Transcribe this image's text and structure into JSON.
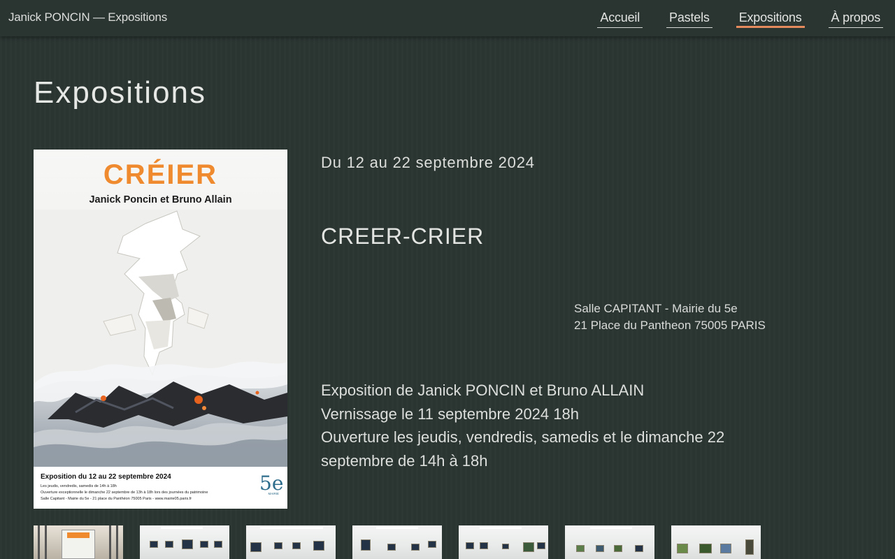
{
  "header": {
    "site_title": "Janick PONCIN — Expositions",
    "nav": [
      {
        "label": "Accueil",
        "active": false
      },
      {
        "label": "Pastels",
        "active": false
      },
      {
        "label": "Expositions",
        "active": true
      },
      {
        "label": "À propos",
        "active": false
      }
    ],
    "accent_color": "#e58a5c"
  },
  "page": {
    "title": "Expositions"
  },
  "exhibition": {
    "date": "Du 12 au 22 septembre 2024",
    "title": "CREER-CRIER",
    "venue_line1": "Salle CAPITANT - Mairie du 5e",
    "venue_line2": "21 Place du Pantheon 75005 PARIS",
    "description": [
      "Exposition de Janick PONCIN et Bruno ALLAIN",
      "Vernissage le 11 septembre 2024 18h",
      "Ouverture les jeudis, vendredis, samedis et le dimanche 22 septembre de 14h à 18h"
    ],
    "poster": {
      "title": "CRÉIER",
      "artists": "Janick Poncin et Bruno Allain",
      "footer_main": "Exposition du 12 au 22 septembre 2024",
      "footer_line1": "Les jeudis, vendredis, samedis de 14h à 18h",
      "footer_line2": "Ouverture exceptionnelle le dimanche 22 septembre de 13h à 18h lors des journées du patrimoine",
      "footer_line3": "Salle Capitant - Mairie du 5e - 21 place du Panthéon 75005 Paris - www.mairie05.paris.fr",
      "logo_text": "5e",
      "logo_label": "MAIRIE",
      "title_color": "#ef8a2e"
    },
    "gallery_count": 7
  }
}
